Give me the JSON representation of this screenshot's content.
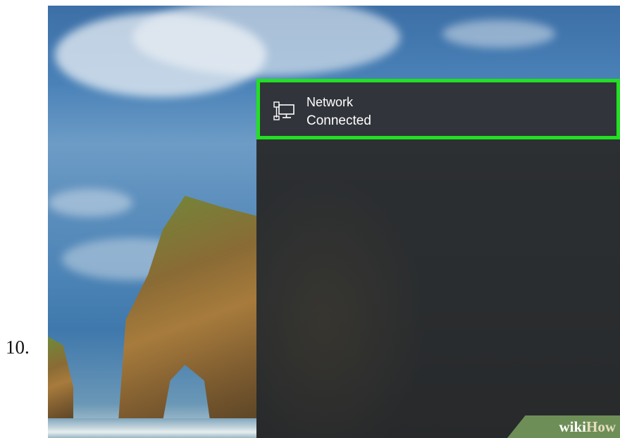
{
  "step": {
    "number": "10."
  },
  "network_tile": {
    "title": "Network",
    "status": "Connected",
    "icon": "ethernet-monitor-icon",
    "highlight_color": "#22e022"
  },
  "watermark": {
    "part1": "wiki",
    "part2": "How"
  }
}
